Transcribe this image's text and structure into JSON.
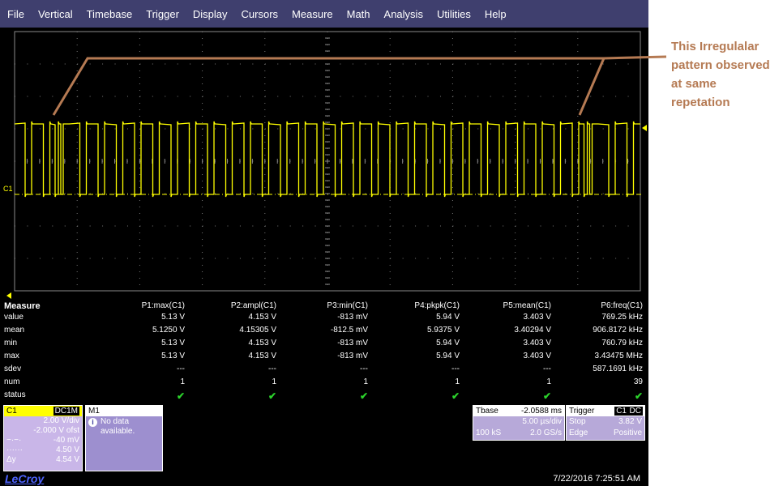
{
  "menu": [
    "File",
    "Vertical",
    "Timebase",
    "Trigger",
    "Display",
    "Cursors",
    "Measure",
    "Math",
    "Analysis",
    "Utilities",
    "Help"
  ],
  "channel_marker": "C1",
  "measure": {
    "title": "Measure",
    "columns": [
      "P1:max(C1)",
      "P2:ampl(C1)",
      "P3:min(C1)",
      "P4:pkpk(C1)",
      "P5:mean(C1)",
      "P6:freq(C1)"
    ],
    "rows": [
      {
        "label": "value",
        "cells": [
          "5.13 V",
          "4.153 V",
          "-813 mV",
          "5.94 V",
          "3.403 V",
          "769.25 kHz"
        ]
      },
      {
        "label": "mean",
        "cells": [
          "5.1250 V",
          "4.15305 V",
          "-812.5 mV",
          "5.9375 V",
          "3.40294 V",
          "906.8172 kHz"
        ]
      },
      {
        "label": "min",
        "cells": [
          "5.13 V",
          "4.153 V",
          "-813 mV",
          "5.94 V",
          "3.403 V",
          "760.79 kHz"
        ]
      },
      {
        "label": "max",
        "cells": [
          "5.13 V",
          "4.153 V",
          "-813 mV",
          "5.94 V",
          "3.403 V",
          "3.43475 MHz"
        ]
      },
      {
        "label": "sdev",
        "cells": [
          "---",
          "---",
          "---",
          "---",
          "---",
          "587.1691 kHz"
        ]
      },
      {
        "label": "num",
        "cells": [
          "1",
          "1",
          "1",
          "1",
          "1",
          "39"
        ]
      },
      {
        "label": "status",
        "cells": [
          "✔",
          "✔",
          "✔",
          "✔",
          "✔",
          "✔"
        ]
      }
    ]
  },
  "c1_panel": {
    "name": "C1",
    "coupling": "DC1M",
    "vdiv": "2.00 V/div",
    "offset": "-2.000 V ofst",
    "l1_sym": "−·−·",
    "l1_val": "-40 mV",
    "l2_sym": "······",
    "l2_val": "4.50 V",
    "l3_sym": "Δy",
    "l3_val": "4.54 V"
  },
  "m1_panel": {
    "name": "M1",
    "msg1": "No data",
    "msg2": "available."
  },
  "timebase_panel": {
    "label": "Tbase",
    "delay": "-2.0588 ms",
    "tdiv": "5.00 µs/div",
    "samples": "100 kS",
    "rate": "2.0 GS/s"
  },
  "trigger_panel": {
    "label": "Trigger",
    "source": "C1",
    "coupling": "DC",
    "mode": "Stop",
    "level": "3.82 V",
    "type": "Edge",
    "slope": "Positive"
  },
  "datetime": "7/22/2016 7:25:51 AM",
  "brand": "LeCroy",
  "annotation": [
    "This Irregulalar",
    "pattern observed",
    "at same",
    "repetation"
  ],
  "colors": {
    "trace": "#ffff00",
    "menubar": "#3f3f6e",
    "annotation": "#b57a53",
    "grid": "#8a8a8a"
  }
}
